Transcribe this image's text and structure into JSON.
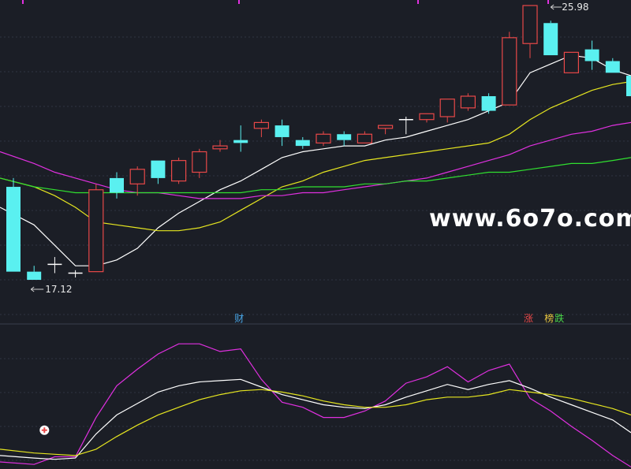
{
  "chart_data": [
    {
      "type": "candlestick",
      "panel": "price",
      "price_range": [
        15.8,
        26.5
      ],
      "grid": "horizontal dashed",
      "candle_colors": {
        "up": "#e84848",
        "down": "#5af0f0",
        "doji": "#ffffff"
      },
      "candles": [
        {
          "o": 20.3,
          "h": 20.6,
          "l": 17.4,
          "c": 17.4
        },
        {
          "o": 17.4,
          "h": 17.6,
          "l": 17.12,
          "c": 17.12
        },
        {
          "o": 17.65,
          "h": 17.9,
          "l": 17.35,
          "c": 17.65
        },
        {
          "o": 17.35,
          "h": 17.45,
          "l": 17.2,
          "c": 17.35
        },
        {
          "o": 17.4,
          "h": 20.4,
          "l": 17.4,
          "c": 20.2
        },
        {
          "o": 20.6,
          "h": 20.8,
          "l": 19.9,
          "c": 20.1
        },
        {
          "o": 20.4,
          "h": 21.0,
          "l": 20.0,
          "c": 20.9
        },
        {
          "o": 21.2,
          "h": 21.2,
          "l": 20.4,
          "c": 20.6
        },
        {
          "o": 20.5,
          "h": 21.3,
          "l": 20.4,
          "c": 21.2
        },
        {
          "o": 20.8,
          "h": 21.6,
          "l": 20.6,
          "c": 21.5
        },
        {
          "o": 21.6,
          "h": 21.9,
          "l": 21.5,
          "c": 21.7
        },
        {
          "o": 21.9,
          "h": 22.4,
          "l": 21.5,
          "c": 21.8
        },
        {
          "o": 22.3,
          "h": 22.6,
          "l": 22.0,
          "c": 22.5
        },
        {
          "o": 22.4,
          "h": 22.6,
          "l": 21.7,
          "c": 22.0
        },
        {
          "o": 21.9,
          "h": 22.0,
          "l": 21.6,
          "c": 21.7
        },
        {
          "o": 21.8,
          "h": 22.2,
          "l": 21.7,
          "c": 22.1
        },
        {
          "o": 22.1,
          "h": 22.2,
          "l": 21.7,
          "c": 21.9
        },
        {
          "o": 21.8,
          "h": 22.2,
          "l": 21.8,
          "c": 22.1
        },
        {
          "o": 22.3,
          "h": 22.4,
          "l": 22.1,
          "c": 22.4
        },
        {
          "o": 22.6,
          "h": 22.7,
          "l": 22.1,
          "c": 22.6
        },
        {
          "o": 22.6,
          "h": 22.8,
          "l": 22.5,
          "c": 22.8
        },
        {
          "o": 22.7,
          "h": 23.3,
          "l": 22.5,
          "c": 23.3
        },
        {
          "o": 23.0,
          "h": 23.5,
          "l": 22.9,
          "c": 23.4
        },
        {
          "o": 23.4,
          "h": 23.5,
          "l": 22.8,
          "c": 22.9
        },
        {
          "o": 23.1,
          "h": 25.6,
          "l": 23.1,
          "c": 25.4
        },
        {
          "o": 25.2,
          "h": 26.5,
          "l": 24.7,
          "c": 26.5
        },
        {
          "o": 25.9,
          "h": 25.98,
          "l": 24.8,
          "c": 24.8
        },
        {
          "o": 24.2,
          "h": 24.9,
          "l": 24.2,
          "c": 24.9
        },
        {
          "o": 25.0,
          "h": 25.3,
          "l": 24.3,
          "c": 24.6
        },
        {
          "o": 24.6,
          "h": 24.7,
          "l": 24.2,
          "c": 24.2
        },
        {
          "o": 24.1,
          "h": 25.0,
          "l": 23.4,
          "c": 23.4
        }
      ],
      "moving_averages": [
        {
          "color": "#ffffff",
          "values": [
            19.6,
            19.0,
            18.3,
            17.6,
            17.6,
            17.8,
            18.2,
            18.9,
            19.4,
            19.8,
            20.2,
            20.5,
            20.9,
            21.3,
            21.5,
            21.6,
            21.7,
            21.7,
            21.9,
            22.0,
            22.2,
            22.4,
            22.6,
            22.9,
            23.2,
            24.2,
            24.5,
            24.8,
            24.7,
            24.3,
            24.1
          ]
        },
        {
          "color": "#e6e620",
          "values": [
            20.6,
            20.3,
            20.0,
            19.6,
            19.1,
            19.0,
            18.9,
            18.8,
            18.8,
            18.9,
            19.1,
            19.5,
            19.9,
            20.3,
            20.5,
            20.8,
            21.0,
            21.2,
            21.3,
            21.4,
            21.5,
            21.6,
            21.7,
            21.8,
            22.1,
            22.6,
            23.0,
            23.3,
            23.6,
            23.8,
            23.9
          ]
        },
        {
          "color": "#e030e0",
          "values": [
            21.5,
            21.1,
            20.8,
            20.6,
            20.4,
            20.2,
            20.1,
            20.1,
            20.0,
            19.9,
            19.9,
            19.9,
            20.0,
            20.0,
            20.1,
            20.1,
            20.2,
            20.3,
            20.4,
            20.5,
            20.6,
            20.8,
            21.0,
            21.2,
            21.4,
            21.7,
            21.9,
            22.1,
            22.2,
            22.4,
            22.5
          ]
        },
        {
          "color": "#30e030",
          "values": [
            20.6,
            20.3,
            20.2,
            20.1,
            20.1,
            20.1,
            20.1,
            20.1,
            20.1,
            20.1,
            20.1,
            20.1,
            20.2,
            20.2,
            20.3,
            20.3,
            20.3,
            20.4,
            20.4,
            20.5,
            20.5,
            20.6,
            20.7,
            20.8,
            20.8,
            20.9,
            21.0,
            21.1,
            21.1,
            21.2,
            21.3
          ]
        }
      ],
      "annotations": [
        {
          "text": "17.12",
          "candle": 1,
          "price": 17.12,
          "side": "left"
        },
        {
          "text": "25.98",
          "candle": 26,
          "price": 26.5,
          "side": "right"
        }
      ],
      "markers": [
        {
          "text": "财",
          "color": "#49a7e8",
          "candle": 11
        },
        {
          "text": "涨",
          "color": "#e84848",
          "candle": 25
        },
        {
          "text": "榜",
          "color": "#e8c640",
          "candle": 26
        },
        {
          "text": "跌",
          "color": "#49d849",
          "candle": 26
        }
      ]
    },
    {
      "type": "line",
      "panel": "indicator",
      "ylim": [
        0,
        100
      ],
      "grid": "horizontal dashed",
      "x": [
        0,
        1,
        2,
        3,
        4,
        5,
        6,
        7,
        8,
        9,
        10,
        11,
        12,
        13,
        14,
        15,
        16,
        17,
        18,
        19,
        20,
        21,
        22,
        23,
        24,
        25,
        26,
        27,
        28,
        29,
        30
      ],
      "series": [
        {
          "color": "#e030e0",
          "values": [
            5,
            3,
            9,
            9,
            40,
            65,
            78,
            90,
            98,
            98,
            92,
            94,
            70,
            52,
            48,
            40,
            40,
            45,
            53,
            67,
            72,
            80,
            68,
            77,
            82,
            55,
            45,
            33,
            22,
            10,
            1
          ]
        },
        {
          "color": "#ffffff",
          "values": [
            10,
            8,
            7,
            8,
            27,
            42,
            51,
            60,
            65,
            68,
            69,
            70,
            64,
            58,
            54,
            50,
            48,
            47,
            50,
            56,
            61,
            66,
            62,
            66,
            69,
            63,
            56,
            50,
            44,
            38,
            28
          ]
        },
        {
          "color": "#e6e620",
          "values": [
            15,
            12,
            11,
            10,
            15,
            25,
            34,
            42,
            48,
            54,
            58,
            61,
            62,
            60,
            57,
            53,
            50,
            48,
            48,
            50,
            54,
            56,
            56,
            58,
            62,
            60,
            58,
            55,
            51,
            47,
            42
          ]
        }
      ],
      "markers": [
        {
          "text": "+",
          "color": "#e84848",
          "x": 1.5,
          "y": 30
        }
      ]
    }
  ],
  "watermark": {
    "text": "www.6o7o.com",
    "color": "#ffffff"
  }
}
